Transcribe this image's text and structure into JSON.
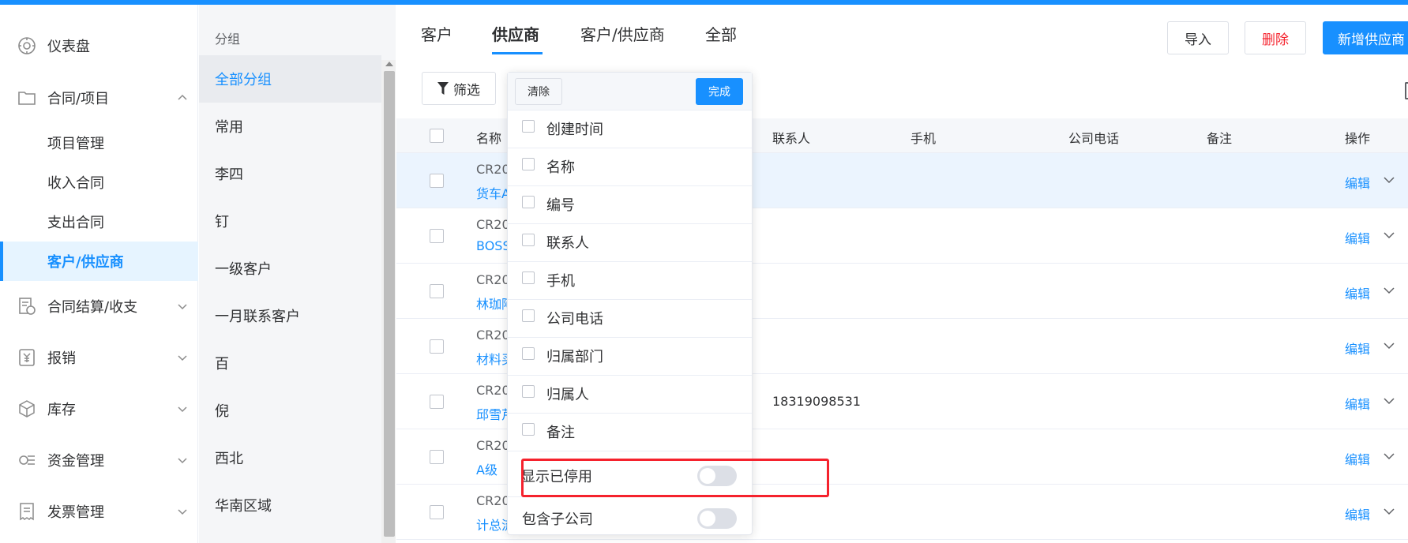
{
  "nav": {
    "items": [
      {
        "label": "仪表盘",
        "icon": "dashboard-icon"
      },
      {
        "label": "合同/项目",
        "icon": "folder-icon",
        "expanded": true
      },
      {
        "label": "合同结算/收支",
        "icon": "settlement-icon"
      },
      {
        "label": "报销",
        "icon": "yuan-icon"
      },
      {
        "label": "库存",
        "icon": "box-icon"
      },
      {
        "label": "资金管理",
        "icon": "fund-icon"
      },
      {
        "label": "发票管理",
        "icon": "invoice-icon"
      }
    ],
    "sub_items": [
      {
        "label": "项目管理"
      },
      {
        "label": "收入合同"
      },
      {
        "label": "支出合同"
      },
      {
        "label": "客户/供应商",
        "active": true
      }
    ]
  },
  "groups": {
    "heading": "分组",
    "items": [
      "全部分组",
      "常用",
      "李四",
      "钉",
      "一级客户",
      "一月联系客户",
      "百",
      "倪",
      "西北",
      "华南区域"
    ],
    "active_index": 0
  },
  "tabs": [
    {
      "label": "客户"
    },
    {
      "label": "供应商",
      "active": true
    },
    {
      "label": "客户/供应商"
    },
    {
      "label": "全部"
    }
  ],
  "toolbar": {
    "import_label": "导入",
    "delete_label": "删除",
    "add_label": "新增供应商",
    "filter_label": "筛选"
  },
  "table": {
    "headers": {
      "name": "名称",
      "contact": "联系人",
      "mobile": "手机",
      "company_phone": "公司电话",
      "remark": "备注",
      "actions": "操作"
    },
    "rows": [
      {
        "code": "CR20",
        "name": "货车A",
        "contact": "",
        "edit": "编辑",
        "highlighted": true
      },
      {
        "code": "CR20",
        "name": "BOSS",
        "contact": "",
        "edit": "编辑"
      },
      {
        "code": "CR20",
        "name": "林珈阿",
        "contact": "",
        "edit": "编辑"
      },
      {
        "code": "CR20",
        "name": "材料买",
        "contact": "",
        "edit": "编辑"
      },
      {
        "code": "CR20",
        "name": "邱雪芹",
        "contact": "18319098531",
        "edit": "编辑"
      },
      {
        "code": "CR20",
        "name": "A级",
        "contact": "",
        "edit": "编辑"
      },
      {
        "code": "CR20",
        "name": "计总流",
        "contact": "",
        "edit": "编辑"
      }
    ]
  },
  "column_popover": {
    "clear_label": "清除",
    "done_label": "完成",
    "options": [
      "创建时间",
      "名称",
      "编号",
      "联系人",
      "手机",
      "公司电话",
      "归属部门",
      "归属人",
      "备注"
    ],
    "switches": [
      {
        "label": "显示已停用",
        "on": false
      },
      {
        "label": "包含子公司",
        "on": false
      }
    ]
  },
  "colors": {
    "primary": "#1890ff",
    "danger": "#f5222d",
    "annotation": "#f5222d"
  }
}
